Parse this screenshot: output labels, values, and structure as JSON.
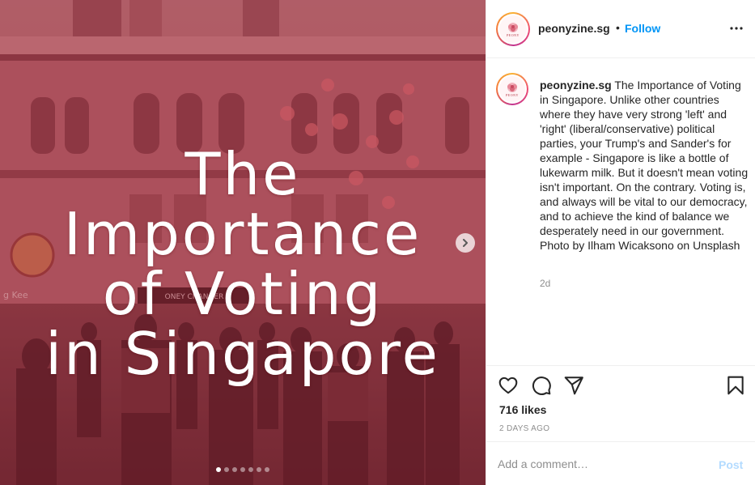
{
  "colors": {
    "accent": "#0095f6",
    "post_disabled": "#b3dbff",
    "media_tint": "#8e3b45",
    "text": "#262626",
    "muted": "#8e8e8e"
  },
  "media": {
    "overlay_title": "The Importance\nof Voting\nin Singapore",
    "sign_text": "ONEY CHANGER",
    "sign_left_text": "g Kee",
    "carousel": {
      "count": 7,
      "active_index": 0
    },
    "next_icon": "chevron-right-icon"
  },
  "header": {
    "username": "peonyzine.sg",
    "separator": "•",
    "follow_label": "Follow",
    "more_icon": "more-horizontal-icon",
    "avatar_label": "PEONY"
  },
  "caption": {
    "username": "peonyzine.sg",
    "text": "The Importance of Voting in Singapore. Unlike other countries where they have very strong 'left' and 'right' (liberal/conservative) political parties, your Trump's and Sander's for example - Singapore is like a bottle of lukewarm milk. But it doesn't mean voting isn't important. On the contrary. Voting is, and always will be vital to our democracy, and to achieve the kind of balance we desperately need in our government.\nPhoto by Ilham Wicaksono on Unsplash",
    "age": "2d"
  },
  "actions": {
    "icons": [
      "heart-icon",
      "comment-icon",
      "share-icon",
      "bookmark-icon"
    ],
    "likes": "716 likes",
    "date": "2 DAYS AGO"
  },
  "comment": {
    "placeholder": "Add a comment…",
    "post_label": "Post"
  }
}
